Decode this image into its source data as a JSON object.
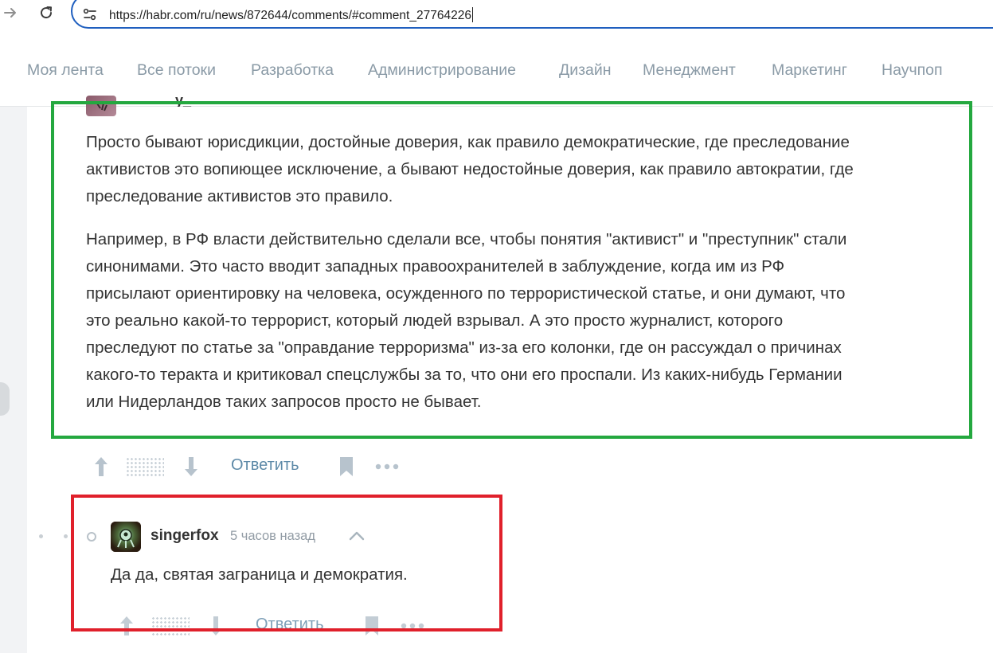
{
  "browser": {
    "url": "https://habr.com/ru/news/872644/comments/#comment_27764226",
    "icons": [
      "forward-arrow-icon",
      "reload-icon",
      "site-info-icon"
    ]
  },
  "hub_nav": {
    "items": [
      "Моя лента",
      "Все потоки",
      "Разработка",
      "Администрирование",
      "Дизайн",
      "Менеджмент",
      "Маркетинг",
      "Научпоп"
    ]
  },
  "comment1": {
    "username_partial": "y_",
    "paragraphs": [
      [
        "Просто бывают юрисдикции, достойные доверия, как правило демократические, где преследование",
        "активистов это вопиющее исключение, а бывают недостойные доверия, как правило автократии, где",
        "преследование активистов это правило."
      ],
      [
        "Например, в РФ власти действительно сделали все, чтобы понятия \"активист\" и \"преступник\" стали",
        "синонимами. Это часто вводит западных правоохранителей в заблуждение, когда им из РФ",
        "присылают ориентировку на человека, осужденного по террористической статье, и они думают, что",
        "это реально какой-то террорист, который людей взрывал. А это просто журналист, которого",
        "преследуют по статье за \"оправдание терроризма\" из-за его колонки, где он рассуждал о причинах",
        "какого-то теракта и критиковал спецслужбы за то, что они его проспали. Из каких-нибудь Германии",
        "или Нидерландов таких запросов просто не бывает."
      ]
    ],
    "actions": {
      "reply": "Ответить"
    }
  },
  "comment2": {
    "username": "singerfox",
    "time": "5 часов назад",
    "text": "Да да, святая заграница и демократия.",
    "actions": {
      "reply": "Ответить"
    }
  },
  "colors": {
    "highlight_green": "#24a83f",
    "highlight_red": "#e0202b",
    "reply_link": "#5e8aa8",
    "nav_link": "#8a9aa6",
    "address_border": "#1f5fbf"
  }
}
